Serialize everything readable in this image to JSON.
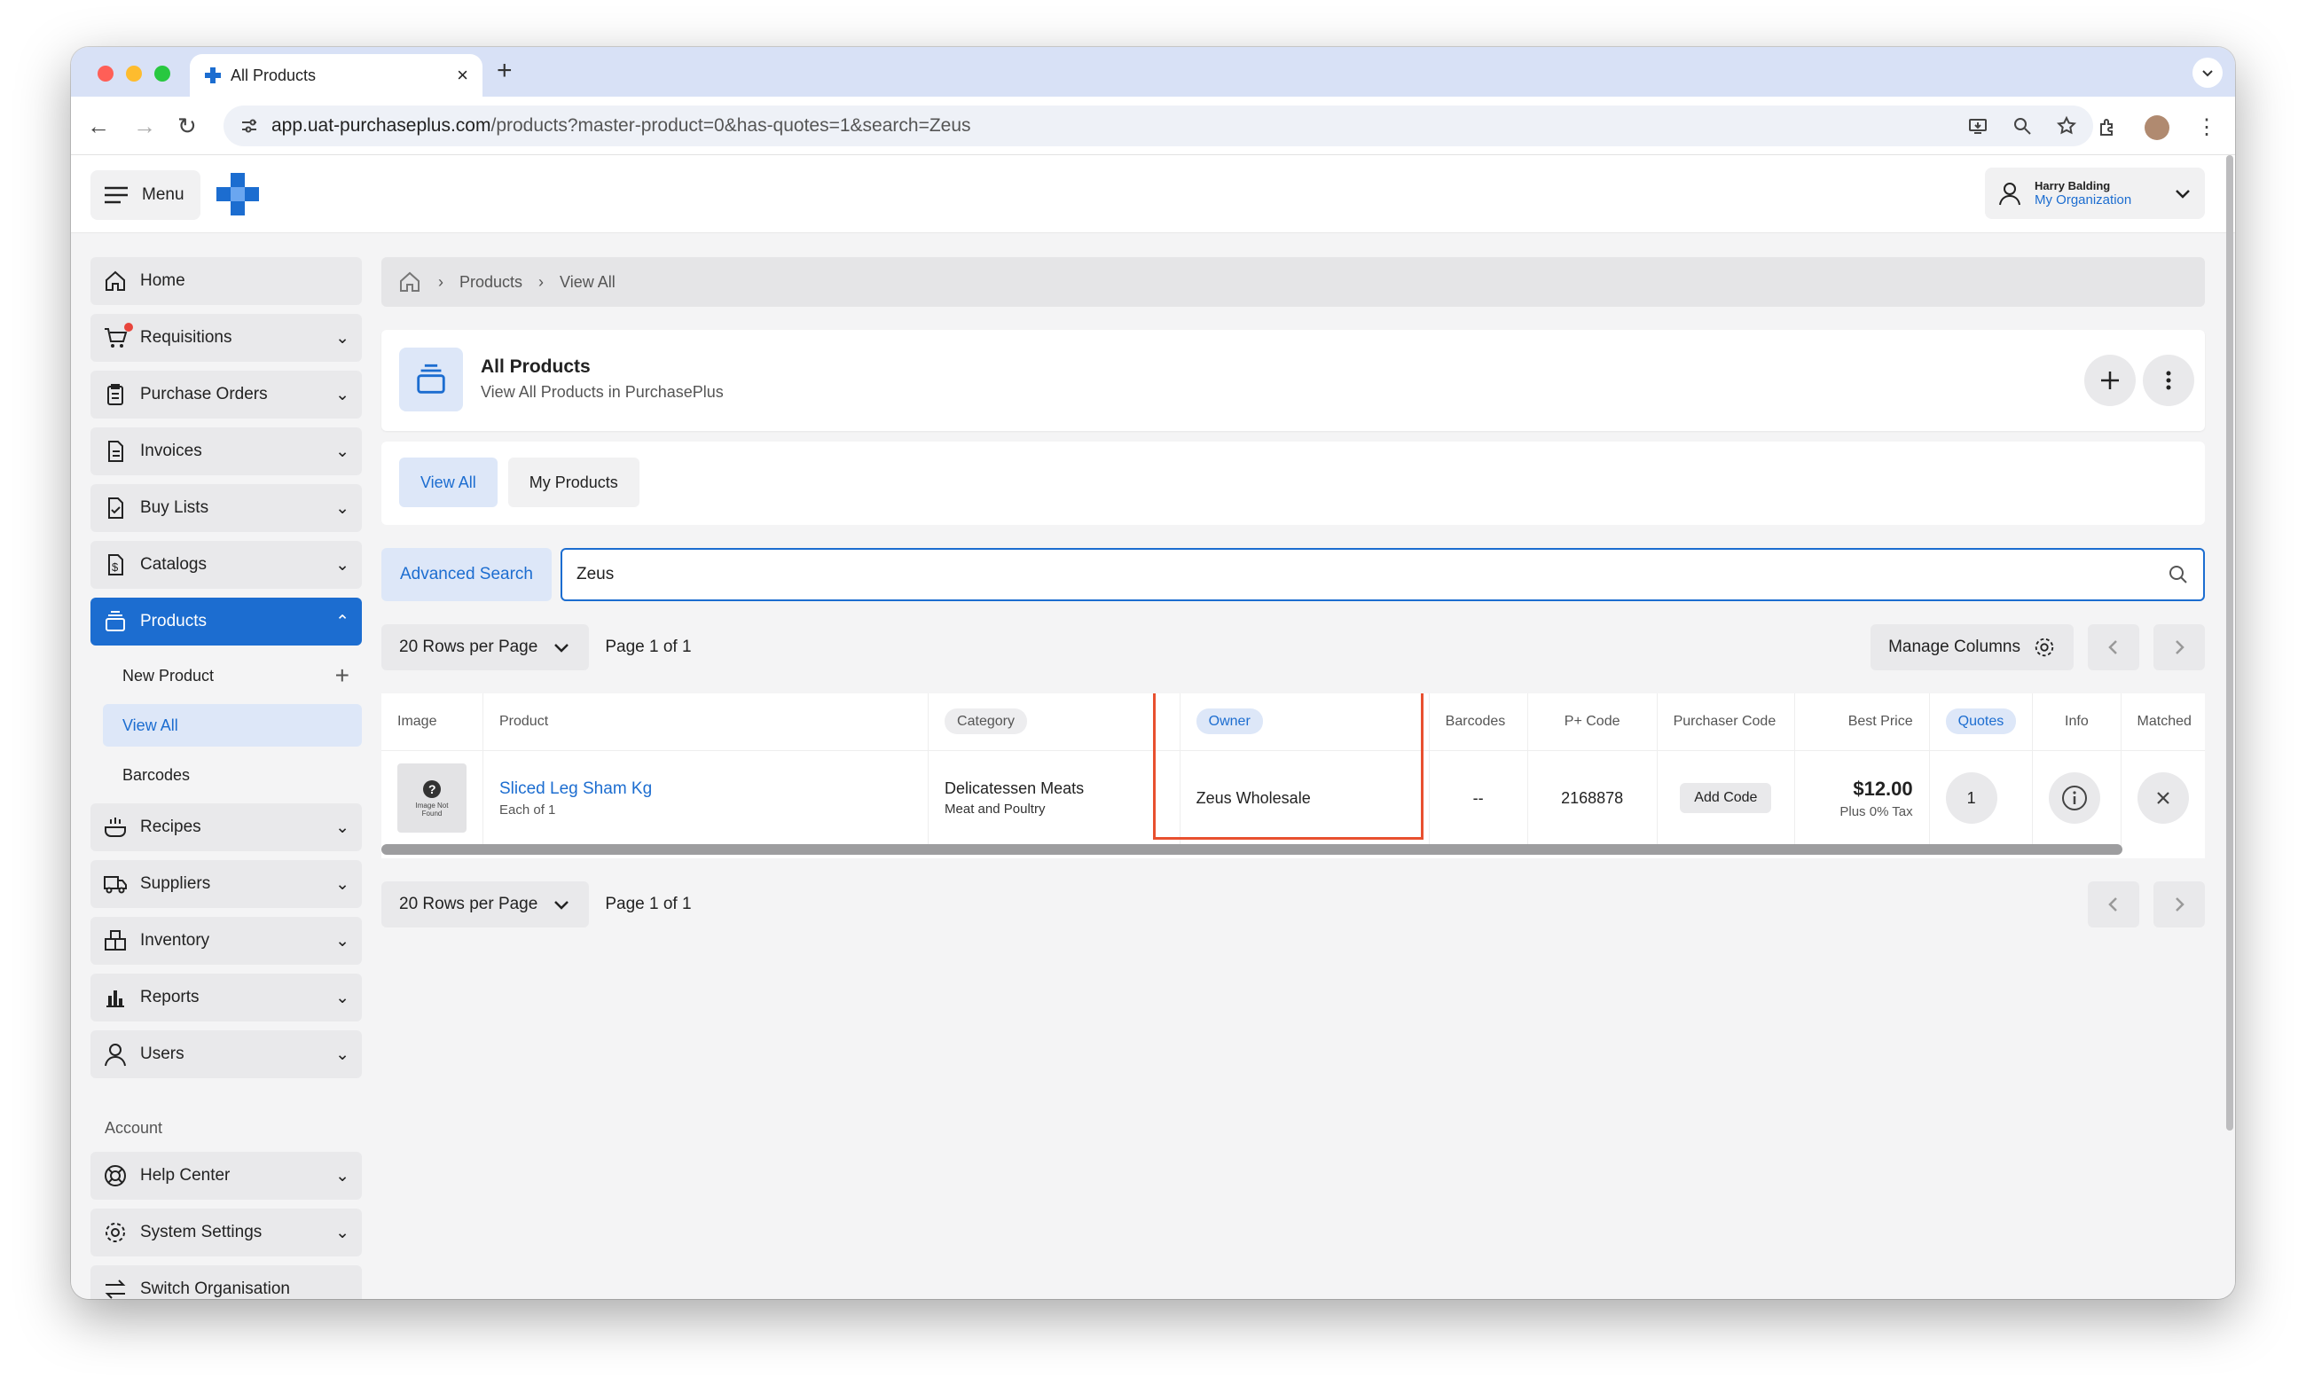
{
  "browser": {
    "tab_title": "All Products",
    "url_host": "app.uat-purchaseplus.com",
    "url_path": "/products?master-product=0&has-quotes=1&search=Zeus"
  },
  "header": {
    "menu_label": "Menu",
    "user_name": "Harry Balding",
    "user_org": "My Organization"
  },
  "sidebar": {
    "items": [
      {
        "label": "Home"
      },
      {
        "label": "Requisitions"
      },
      {
        "label": "Purchase Orders"
      },
      {
        "label": "Invoices"
      },
      {
        "label": "Buy Lists"
      },
      {
        "label": "Catalogs"
      },
      {
        "label": "Products"
      }
    ],
    "products_sub": [
      "New Product",
      "View All",
      "Barcodes"
    ],
    "items2": [
      {
        "label": "Recipes"
      },
      {
        "label": "Suppliers"
      },
      {
        "label": "Inventory"
      },
      {
        "label": "Reports"
      },
      {
        "label": "Users"
      }
    ],
    "account_label": "Account",
    "account_items": [
      {
        "label": "Help Center"
      },
      {
        "label": "System Settings"
      },
      {
        "label": "Switch Organisation"
      }
    ]
  },
  "breadcrumb": [
    "Products",
    "View All"
  ],
  "page": {
    "title": "All Products",
    "subtitle": "View All Products in PurchasePlus"
  },
  "tabs": [
    "View All",
    "My Products"
  ],
  "search": {
    "advanced_label": "Advanced Search",
    "value": "Zeus"
  },
  "pager": {
    "rows_label": "20 Rows per Page",
    "page_info": "Page 1 of 1",
    "manage_columns": "Manage Columns"
  },
  "table": {
    "headers": [
      "Image",
      "Product",
      "Category",
      "Owner",
      "Barcodes",
      "P+ Code",
      "Purchaser Code",
      "Best Price",
      "Quotes",
      "Info",
      "Matched"
    ],
    "row": {
      "image_text": "Image Not Found",
      "product_name": "Sliced Leg Sham Kg",
      "product_unit": "Each of 1",
      "category": "Delicatessen Meats",
      "subcategory": "Meat and Poultry",
      "owner": "Zeus Wholesale",
      "barcodes": "--",
      "pcode": "2168878",
      "purchaser_code_btn": "Add Code",
      "best_price": "$12.00",
      "tax": "Plus 0% Tax",
      "quotes": "1"
    }
  },
  "colors": {
    "accent": "#1c6dd0",
    "highlight": "#e8502f"
  }
}
